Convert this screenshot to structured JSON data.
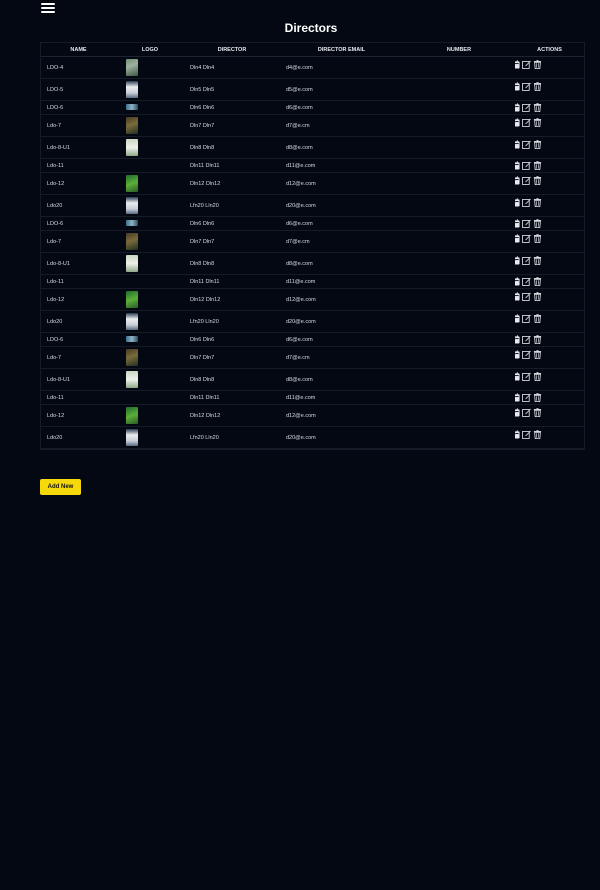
{
  "page": {
    "title": "Directors",
    "add_button": "Add New"
  },
  "colors": {
    "background": "#030812",
    "add_button": "#f5d90a"
  },
  "table": {
    "headers": [
      "NAME",
      "LOGO",
      "DIRECTOR",
      "DIRECTOR EMAIL",
      "NUMBER",
      "ACTIONS"
    ],
    "rows": [
      {
        "name": "LDO-4",
        "director": "Dln4 Dln4",
        "email": "d4@e.com",
        "number": "",
        "logo": "photo-green"
      },
      {
        "name": "LDO-5",
        "director": "Dln5 Dln5",
        "email": "d5@e.com",
        "number": "",
        "logo": "photo-white"
      },
      {
        "name": "LDO-6",
        "director": "Dln6 Dln6",
        "email": "d6@e.com",
        "number": "",
        "logo": "photo-blue-small"
      },
      {
        "name": "Ldo-7",
        "director": "Dln7 Dln7",
        "email": "d7@e.cm",
        "number": "",
        "logo": "photo-dark"
      },
      {
        "name": "Ldo-8-U1",
        "director": "Dln8 Dln8",
        "email": "d8@e.com",
        "number": "",
        "logo": "photo-light"
      },
      {
        "name": "Ldo-11",
        "director": "Dln11 Dln11",
        "email": "d11@e.com",
        "number": "",
        "logo": "none"
      },
      {
        "name": "Ldo-12",
        "director": "Dln12 Dln12",
        "email": "d12@e.com",
        "number": "",
        "logo": "photo-leaf"
      },
      {
        "name": "Ldo20",
        "director": "Lfn20 Lln20",
        "email": "d20@e.com",
        "number": "",
        "logo": "photo-white"
      },
      {
        "name": "LDO-6",
        "director": "Dln6 Dln6",
        "email": "d6@e.com",
        "number": "",
        "logo": "photo-blue-small"
      },
      {
        "name": "Ldo-7",
        "director": "Dln7 Dln7",
        "email": "d7@e.cm",
        "number": "",
        "logo": "photo-dark"
      },
      {
        "name": "Ldo-8-U1",
        "director": "Dln8 Dln8",
        "email": "d8@e.com",
        "number": "",
        "logo": "photo-light"
      },
      {
        "name": "Ldo-11",
        "director": "Dln11 Dln11",
        "email": "d11@e.com",
        "number": "",
        "logo": "none"
      },
      {
        "name": "Ldo-12",
        "director": "Dln12 Dln12",
        "email": "d12@e.com",
        "number": "",
        "logo": "photo-leaf"
      },
      {
        "name": "Ldo20",
        "director": "Lfn20 Lln20",
        "email": "d20@e.com",
        "number": "",
        "logo": "photo-white"
      },
      {
        "name": "LDO-6",
        "director": "Dln6 Dln6",
        "email": "d6@e.com",
        "number": "",
        "logo": "photo-blue-small"
      },
      {
        "name": "Ldo-7",
        "director": "Dln7 Dln7",
        "email": "d7@e.cm",
        "number": "",
        "logo": "photo-dark"
      },
      {
        "name": "Ldo-8-U1",
        "director": "Dln8 Dln8",
        "email": "d8@e.com",
        "number": "",
        "logo": "photo-light"
      },
      {
        "name": "Ldo-11",
        "director": "Dln11 Dln11",
        "email": "d11@e.com",
        "number": "",
        "logo": "none"
      },
      {
        "name": "Ldo-12",
        "director": "Dln12 Dln12",
        "email": "d12@e.com",
        "number": "",
        "logo": "photo-leaf"
      },
      {
        "name": "Ldo20",
        "director": "Lfn20 Lln20",
        "email": "d20@e.com",
        "number": "",
        "logo": "photo-white"
      }
    ],
    "action_icons": [
      "calendar-icon",
      "edit-icon",
      "trash-icon"
    ]
  }
}
